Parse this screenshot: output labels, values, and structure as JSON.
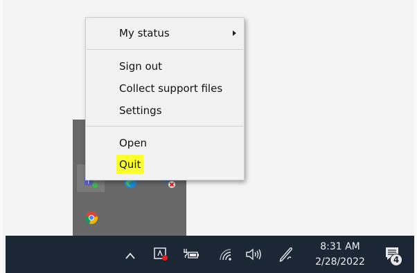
{
  "context_menu": {
    "items": [
      {
        "label": "My status",
        "has_submenu": true
      },
      {
        "label": "Sign out"
      },
      {
        "label": "Collect support files"
      },
      {
        "label": "Settings"
      },
      {
        "label": "Open"
      },
      {
        "label": "Quit",
        "highlight_color": "#fbff2e"
      }
    ]
  },
  "tray_flyout": {
    "icons": [
      "teams-icon",
      "edge-icon",
      "disconnected-app-icon",
      "chrome-icon"
    ]
  },
  "taskbar": {
    "icons": [
      "chevron-up-icon",
      "recording-indicator-icon",
      "battery-plug-icon",
      "wifi-icon",
      "speaker-icon",
      "pen-icon"
    ],
    "clock": {
      "time": "8:31 AM",
      "date": "2/28/2022"
    },
    "notifications": {
      "count": "4"
    },
    "background": "#1c2736"
  }
}
